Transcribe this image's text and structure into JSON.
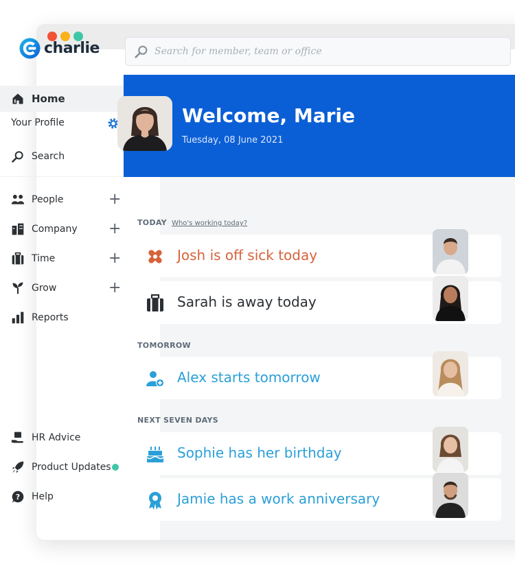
{
  "app": {
    "name": "charlie",
    "accent": "#0b5fd6",
    "secondary_accent": "#2b9fd8"
  },
  "search": {
    "placeholder": "Search for member, team or office"
  },
  "sidebar": {
    "home": "Home",
    "profile": "Your Profile",
    "search": "Search",
    "items": [
      {
        "label": "People",
        "icon": "people-icon"
      },
      {
        "label": "Company",
        "icon": "building-icon"
      },
      {
        "label": "Time",
        "icon": "luggage-icon"
      },
      {
        "label": "Grow",
        "icon": "sprout-icon"
      },
      {
        "label": "Reports",
        "icon": "bar-chart-icon"
      }
    ],
    "bottom": [
      {
        "label": "HR Advice",
        "icon": "hand-advice-icon"
      },
      {
        "label": "Product Updates",
        "icon": "rocket-icon"
      },
      {
        "label": "Help",
        "icon": "help-icon"
      }
    ]
  },
  "banner": {
    "welcome": "Welcome, Marie",
    "date": "Tuesday, 08 June 2021"
  },
  "sections": {
    "today": {
      "label": "TODAY",
      "link": "Who's working today?"
    },
    "tomorrow": {
      "label": "TOMORROW"
    },
    "next7": {
      "label": "NEXT SEVEN DAYS"
    }
  },
  "cards": [
    {
      "text": "Josh is off sick today",
      "icon": "bandage-icon",
      "color": "#d8623b"
    },
    {
      "text": "Sarah is away today",
      "icon": "suitcase-icon",
      "color": "#2b2f33"
    },
    {
      "text": "Alex starts tomorrow",
      "icon": "add-user-icon",
      "color": "#2b9fd8"
    },
    {
      "text": "Sophie has her birthday",
      "icon": "cake-icon",
      "color": "#2b9fd8"
    },
    {
      "text": "Jamie has a work anniversary",
      "icon": "award-icon",
      "color": "#2b9fd8"
    }
  ]
}
